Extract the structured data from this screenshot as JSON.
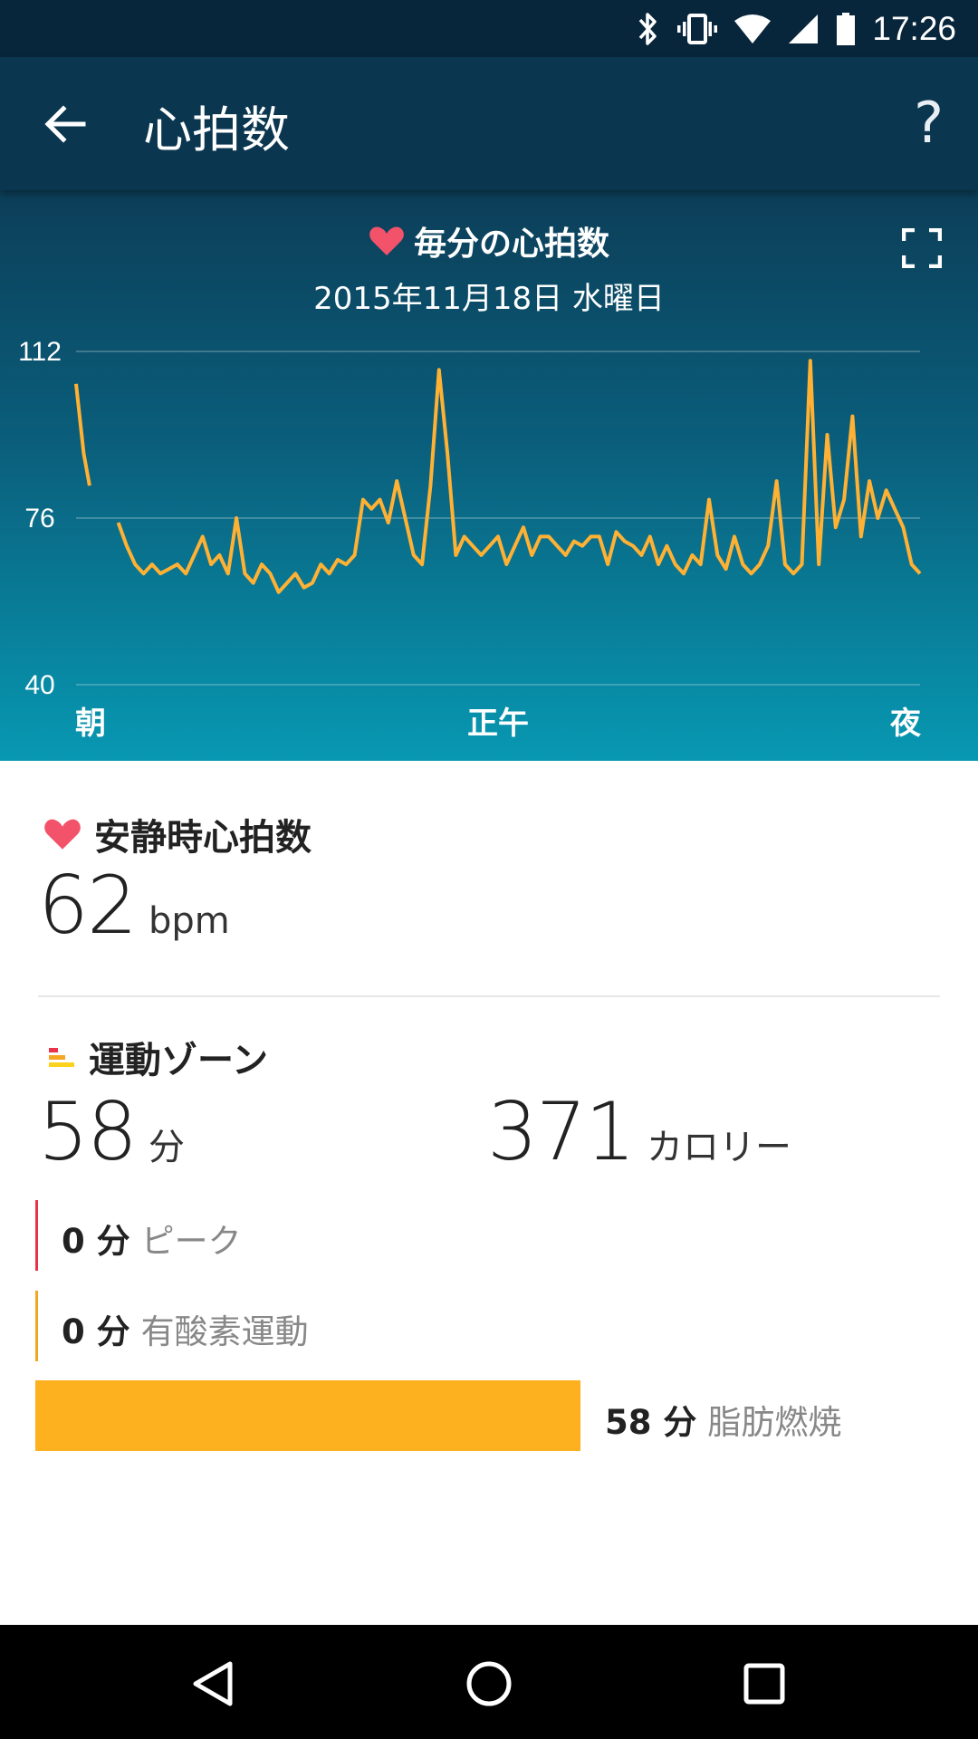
{
  "status_bar": {
    "time": "17:26"
  },
  "app_bar": {
    "title": "心拍数",
    "help_label": "?"
  },
  "chart": {
    "title": "毎分の心拍数",
    "date": "2015年11月18日 水曜日"
  },
  "chart_data": {
    "type": "line",
    "title": "毎分の心拍数",
    "subtitle": "2015年11月18日 水曜日",
    "yticks": [
      "112",
      "76",
      "40"
    ],
    "ylim": [
      40,
      112
    ],
    "xticks": [
      "朝",
      "正午",
      "夜"
    ],
    "grid": true,
    "series": [
      {
        "color": "#ffb134",
        "segments": [
          {
            "x": [
              0,
              0.3,
              0.6,
              0.9,
              1.2,
              1.6
            ],
            "y": [
              105,
              100,
              95,
              90,
              87,
              83
            ]
          },
          {
            "x": [
              5,
              6,
              7,
              8,
              9,
              10,
              11,
              12,
              13,
              14,
              15,
              16,
              17,
              18,
              19,
              20,
              21,
              22,
              23,
              24,
              25,
              26,
              27,
              28,
              29,
              30,
              31,
              32,
              33,
              34,
              35,
              36,
              37,
              38,
              39,
              40,
              41,
              42,
              43,
              44,
              45,
              46,
              47,
              48,
              49,
              50,
              51,
              52,
              53,
              54,
              55,
              56,
              57,
              58,
              59,
              60,
              61,
              62,
              63,
              64,
              65,
              66,
              67,
              68,
              69,
              70,
              71,
              72,
              73,
              74,
              75,
              76,
              77,
              78,
              79,
              80,
              81,
              82,
              83,
              84,
              85,
              86,
              87,
              88,
              89,
              90,
              91,
              92,
              93,
              94,
              95,
              96,
              97,
              98,
              99,
              100
            ],
            "y": [
              75,
              70,
              66,
              64,
              66,
              64,
              65,
              66,
              64,
              68,
              72,
              66,
              68,
              64,
              76,
              64,
              62,
              66,
              64,
              60,
              62,
              64,
              61,
              62,
              66,
              64,
              67,
              66,
              68,
              80,
              78,
              80,
              75,
              84,
              76,
              68,
              66,
              83,
              108,
              90,
              68,
              72,
              70,
              68,
              70,
              72,
              66,
              70,
              74,
              68,
              72,
              72,
              70,
              68,
              71,
              70,
              72,
              72,
              66,
              73,
              71,
              70,
              68,
              72,
              66,
              70,
              66,
              64,
              68,
              66,
              80,
              68,
              65,
              72,
              66,
              64,
              66,
              70,
              84,
              66,
              64,
              66,
              110,
              66,
              94,
              74,
              80,
              98,
              72,
              84,
              76,
              82,
              78,
              74,
              66,
              64
            ]
          }
        ]
      }
    ]
  },
  "resting": {
    "heading": "安静時心拍数",
    "value": "62",
    "unit": "bpm"
  },
  "zones": {
    "heading": "運動ゾーン",
    "minutes_value": "58",
    "minutes_unit": "分",
    "calories_value": "371",
    "calories_unit": "カロリー",
    "peak": {
      "value": "0 分",
      "label": "ピーク",
      "color": "#e8334a",
      "fraction": 0
    },
    "cardio": {
      "value": "0 分",
      "label": "有酸素運動",
      "color": "#f5a623",
      "fraction": 0
    },
    "fat_burn": {
      "value": "58 分",
      "label": "脂肪燃焼",
      "color": "#fdb11f",
      "fraction": 1
    }
  },
  "colors": {
    "accent_line": "#ffb134",
    "heart": "#f2536a",
    "fat_burn": "#fdb11f"
  },
  "icons": {
    "back": "arrow-left-icon",
    "help": "question-icon",
    "expand": "fullscreen-icon",
    "heart": "heart-icon",
    "zones": "zone-bars-icon",
    "nav_back": "triangle-back-icon",
    "nav_home": "circle-home-icon",
    "nav_recent": "square-recent-icon"
  }
}
